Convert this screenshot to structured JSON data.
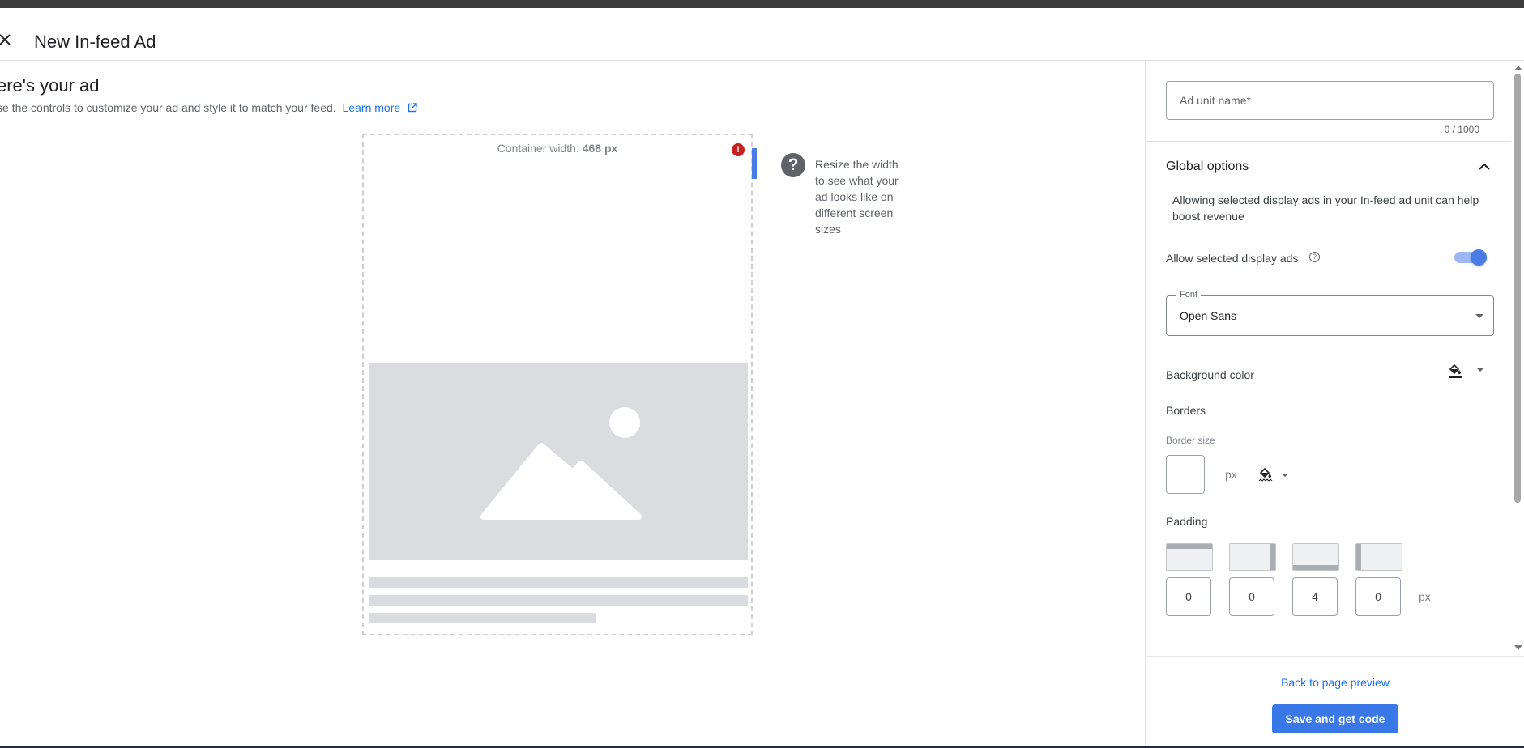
{
  "header": {
    "title": "New In-feed Ad",
    "close_icon": "close-icon"
  },
  "main": {
    "title": "ere's your ad",
    "subtitle": "se the controls to customize your ad and style it to match your feed.",
    "learn_more": "Learn more",
    "container_width_label": "Container width:",
    "container_width_value": "468 px",
    "resize_hint": "Resize the width to see what your ad looks like on different screen sizes",
    "help_symbol": "?",
    "warning_symbol": "!"
  },
  "panel": {
    "ad_unit_name_placeholder": "Ad unit name*",
    "char_counter": "0 / 1000",
    "global_options_title": "Global options",
    "global_options_desc": "Allowing selected display ads in your In-feed ad unit can help boost revenue",
    "allow_display_ads_label": "Allow selected display ads",
    "allow_display_ads_on": true,
    "font_legend": "Font",
    "font_value": "Open Sans",
    "background_color_label": "Background color",
    "borders_label": "Borders",
    "border_size_label": "Border size",
    "border_size_value": "",
    "unit_px": "px",
    "padding_label": "Padding",
    "padding_values": [
      "0",
      "0",
      "4",
      "0"
    ],
    "back_link": "Back to page preview",
    "save_button": "Save and get code"
  },
  "colors": {
    "accent": "#3b78e7",
    "link": "#1a73e8",
    "warning": "#c5221f"
  }
}
